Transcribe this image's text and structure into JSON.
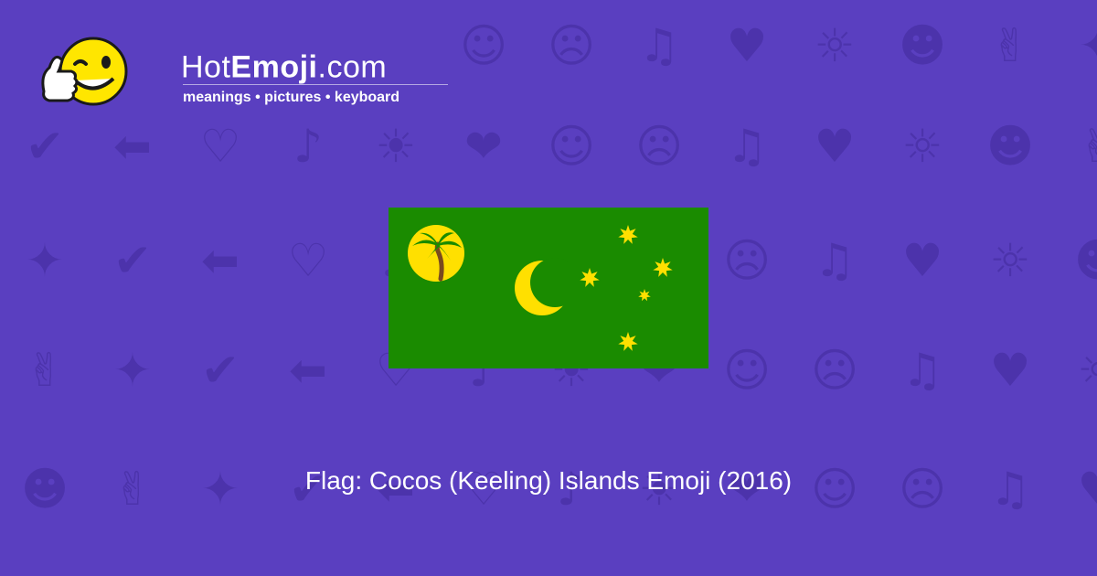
{
  "brand": {
    "name_prefix": "Hot",
    "name_bold": "Emoji",
    "name_suffix": ".com",
    "tagline": "meanings • pictures • keyboard"
  },
  "caption": "Flag: Cocos (Keeling) Islands Emoji (2016)",
  "flag": {
    "icon": "flag-cocos-keeling-islands-icon",
    "colors": {
      "field": "#1a8b00",
      "emblem": "#ffe000",
      "trunk": "#7a4a1e",
      "leaves": "#1a8b00"
    }
  },
  "colors": {
    "background": "#5a3fc0",
    "pattern": "#4a32a8",
    "text": "#ffffff"
  },
  "background_icons": [
    "☺",
    "☻",
    "♡",
    "☹",
    "✌",
    "♪",
    "♫",
    "✦",
    "☀",
    "♥",
    "✔",
    "❤",
    "☼",
    "⬅"
  ]
}
